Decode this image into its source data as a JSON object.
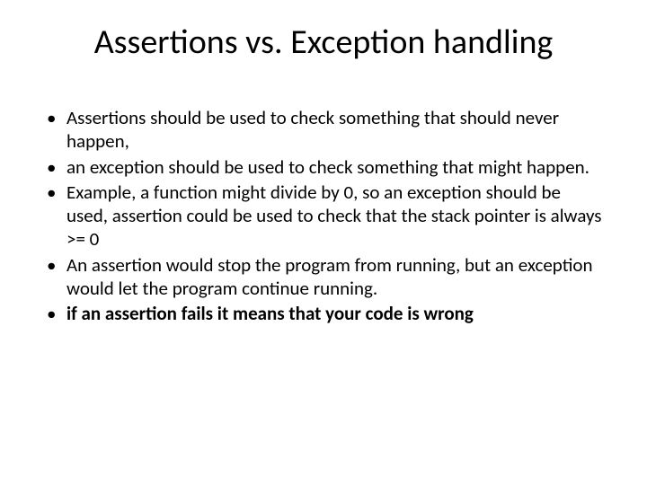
{
  "title": "Assertions vs. Exception handling",
  "bullets": [
    {
      "text": "Assertions should be used to check something that should never happen,",
      "bold": false
    },
    {
      "text": "an exception should be used to check something that might happen.",
      "bold": false
    },
    {
      "text": "Example, a function might divide by 0, so an exception should be used, assertion could be used to check that the stack pointer is always >= 0",
      "bold": false
    },
    {
      "text": "An assertion would stop the program from running, but an exception would let the program continue running.",
      "bold": false
    },
    {
      "text": " if an assertion fails it means that your code is wrong",
      "bold": true
    }
  ]
}
